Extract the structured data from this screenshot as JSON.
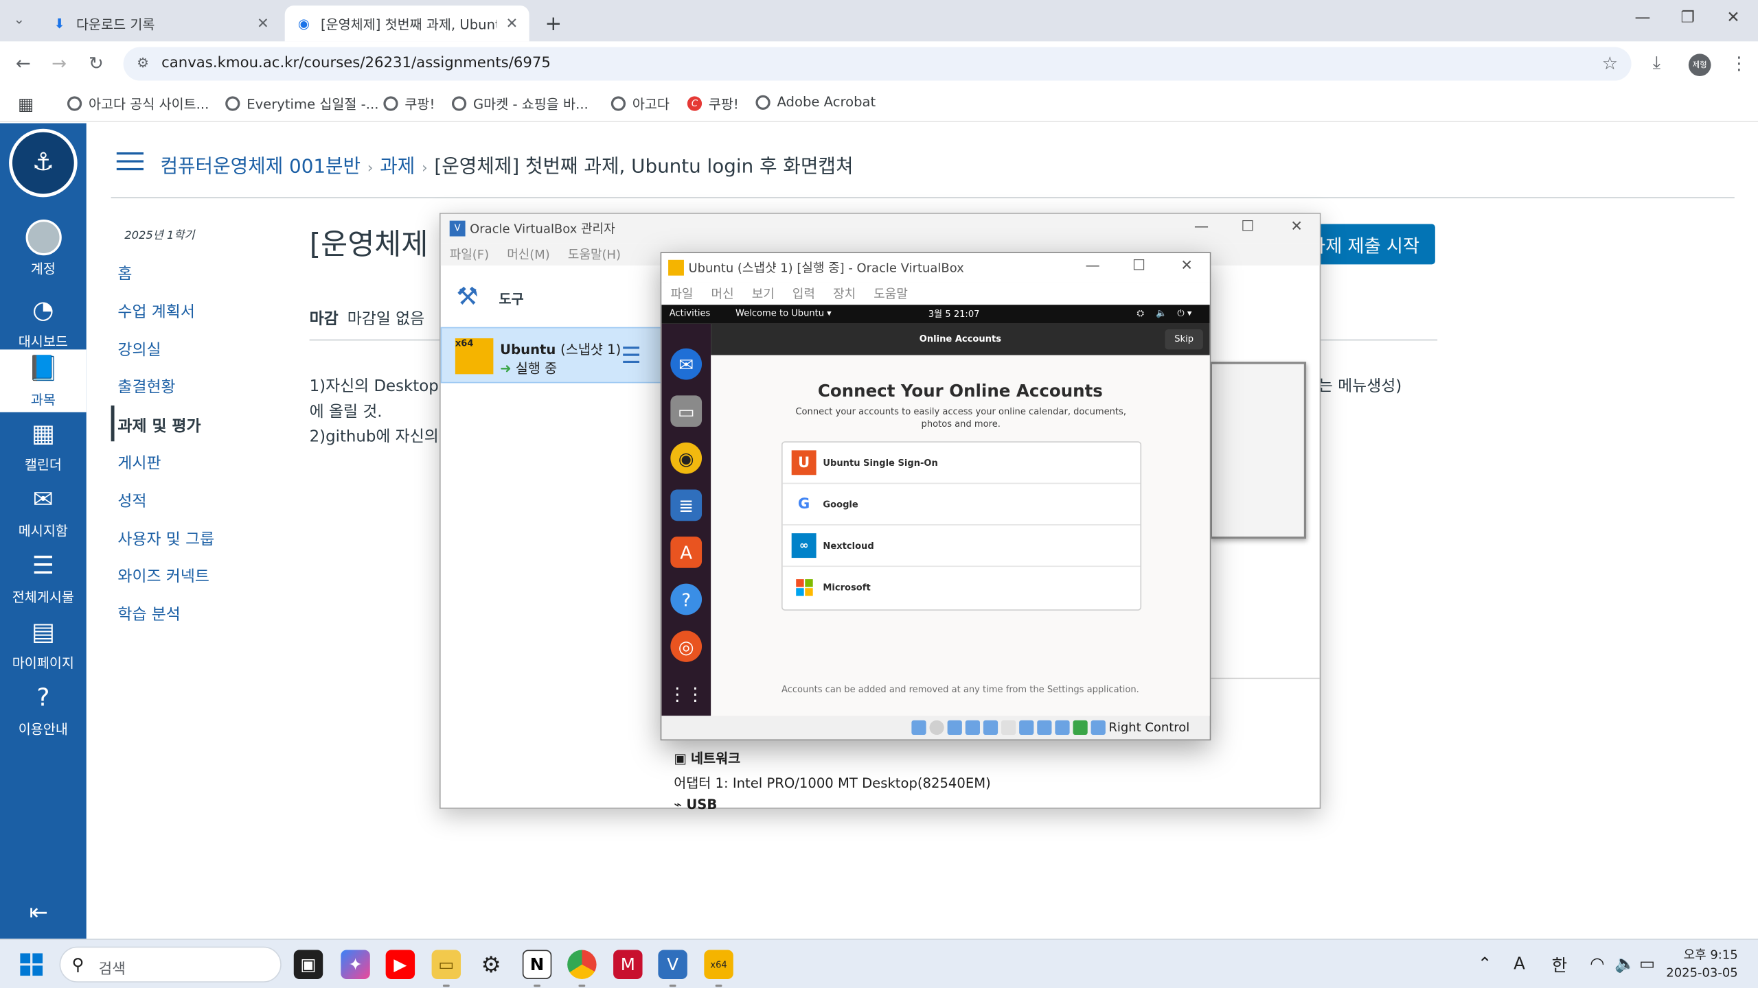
{
  "browser": {
    "tabs": [
      {
        "title": "다운로드 기록",
        "icon": "download-icon"
      },
      {
        "title": "[운영체제] 첫번째 과제, Ubuntu",
        "icon": "canvas-icon"
      }
    ],
    "new_tab": "+",
    "url": "canvas.kmou.ac.kr/courses/26231/assignments/6975",
    "profile": "제형",
    "bookmarks": [
      "아고다 공식 사이트...",
      "Everytime 십일절 -...",
      "쿠팡!",
      "G마켓 - 쇼핑을 바...",
      "아고다",
      "쿠팡!",
      "Adobe Acrobat"
    ]
  },
  "global_nav": [
    {
      "label": "계정",
      "icon": "account-icon"
    },
    {
      "label": "대시보드",
      "icon": "dashboard-icon"
    },
    {
      "label": "과목",
      "icon": "courses-icon"
    },
    {
      "label": "캘린더",
      "icon": "calendar-icon"
    },
    {
      "label": "메시지함",
      "icon": "inbox-icon"
    },
    {
      "label": "전체게시물",
      "icon": "all-posts-icon"
    },
    {
      "label": "마이페이지",
      "icon": "mypage-icon"
    },
    {
      "label": "이용안내",
      "icon": "help-icon"
    }
  ],
  "breadcrumb": {
    "course": "컴퓨터운영체제 001분반",
    "section": "과제",
    "current": "[운영체제] 첫번째 과제, Ubuntu login 후 화면캡쳐"
  },
  "course_nav": {
    "term": "2025년 1학기",
    "items": [
      "홈",
      "수업 계획서",
      "강의실",
      "출결현황",
      "과제 및 평가",
      "게시판",
      "성적",
      "사용자 및 그룹",
      "와이즈 커넥트",
      "학습 분석"
    ]
  },
  "assignment": {
    "title": "[운영체제",
    "submit": "과제 제출 시작",
    "due_label": "마감",
    "due_value": "마감일 없음",
    "desc_line1": "1)자신의 Desktop",
    "desc_line2": "에 올릴 것.",
    "desc_line3": "2)github에 자신의",
    "desc_right": "라는 메뉴생성)"
  },
  "vbox_manager": {
    "title": "Oracle VirtualBox 관리자",
    "menu": [
      "파일(F)",
      "머신(M)",
      "도움말(H)"
    ],
    "tools": "도구",
    "vm_name": "Ubuntu",
    "vm_snapshot": "(스냅샷 1)",
    "vm_state": "실행 중",
    "vm_arch": "x64",
    "network_header": "네트워크",
    "adapter": "어댑터 1:   Intel PRO/1000 MT Desktop(82540EM)",
    "usb_header": "USB"
  },
  "vm_window": {
    "title": "Ubuntu (스냅샷 1) [실행 중] - Oracle VirtualBox",
    "menu": [
      "파일",
      "머신",
      "보기",
      "입력",
      "장치",
      "도움말"
    ],
    "host_key": "Right Control"
  },
  "guest": {
    "activities": "Activities",
    "app_menu": "Welcome to Ubuntu ▾",
    "clock": "3월 5 21:07",
    "header": "Online Accounts",
    "skip": "Skip",
    "heading": "Connect Your Online Accounts",
    "subtitle": "Connect your accounts to easily access your online calendar, documents, photos and more.",
    "providers": [
      "Ubuntu Single Sign-On",
      "Google",
      "Nextcloud",
      "Microsoft"
    ],
    "footer": "Accounts can be added and removed at any time from the Settings application."
  },
  "taskbar": {
    "search": "검색",
    "tray_lang": "한",
    "tray_font": "A",
    "time": "오후 9:15",
    "date": "2025-03-05"
  }
}
